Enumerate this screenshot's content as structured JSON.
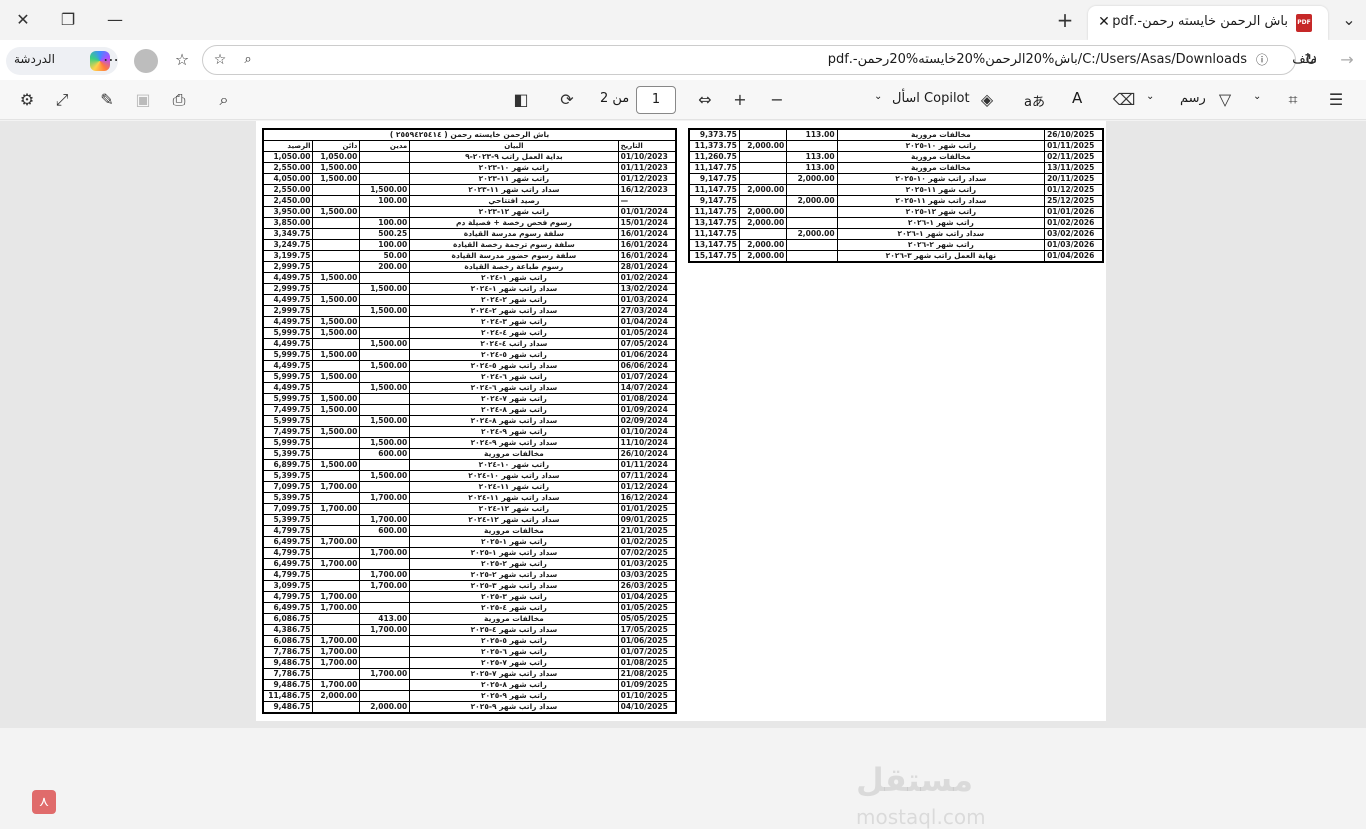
{
  "window": {
    "tab_title": "باش الرحمن خايسته رحمن-.pdf",
    "close": "✕",
    "new_tab": "+",
    "minimize": "—",
    "restore": "❐",
    "window_close": "✕",
    "tabs_menu": "⌄"
  },
  "address": {
    "copilot_label": "الدردشة",
    "file_label": "ملف",
    "url": "C:/Users/Asas/Downloads/باش%20الرحمن%20خايسته%20رحمن-.pdf"
  },
  "toolbar": {
    "draw_label": "رسم",
    "ask_copilot": "اسأل Copilot",
    "page_number": "1",
    "page_of": "من 2",
    "translate": "aあ",
    "read_aloud": "A",
    "zoom_in": "+",
    "zoom_out": "−"
  },
  "page_title": "باش الرحمن خايسته رحمن ( ٢٥٥٩٤٢٥٤١٤ )",
  "headers": {
    "date": "التاريخ",
    "desc": "البيان",
    "debit": "مدين",
    "credit": "دائن",
    "balance": "الرصيد"
  },
  "rows_left": [
    [
      "01/10/2023",
      "بداية العمل راتب ٩-٢٠٢٣-٩",
      "",
      "1,050.00",
      "1,050.00"
    ],
    [
      "01/11/2023",
      "راتب شهر ١٠-٢٠٢٣",
      "",
      "1,500.00",
      "2,550.00"
    ],
    [
      "01/12/2023",
      "راتب شهر ١١-٢٠٢٣",
      "",
      "1,500.00",
      "4,050.00"
    ],
    [
      "16/12/2023",
      "سداد راتب شهر ١١-٢٠٢٣",
      "1,500.00",
      "",
      "2,550.00"
    ],
    [
      "—",
      "رصيد افتتاحي",
      "100.00",
      "",
      "2,450.00"
    ],
    [
      "01/01/2024",
      "راتب شهر ١٢-٢٠٢٣",
      "",
      "1,500.00",
      "3,950.00"
    ],
    [
      "15/01/2024",
      "رسوم فحص رخصة + فصيلة دم",
      "100.00",
      "",
      "3,850.00"
    ],
    [
      "16/01/2024",
      "سلفة رسوم مدرسة القيادة",
      "500.25",
      "",
      "3,349.75"
    ],
    [
      "16/01/2024",
      "سلفة رسوم ترجمة رخصة القيادة",
      "100.00",
      "",
      "3,249.75"
    ],
    [
      "16/01/2024",
      "سلفة رسوم حضور مدرسة القيادة",
      "50.00",
      "",
      "3,199.75"
    ],
    [
      "28/01/2024",
      "رسوم طباعة رخصة القيادة",
      "200.00",
      "",
      "2,999.75"
    ],
    [
      "01/02/2024",
      "راتب شهر ١-٢٠٢٤",
      "",
      "1,500.00",
      "4,499.75"
    ],
    [
      "13/02/2024",
      "سداد راتب شهر ١-٢٠٢٤",
      "1,500.00",
      "",
      "2,999.75"
    ],
    [
      "01/03/2024",
      "راتب شهر ٢-٢٠٢٤",
      "",
      "1,500.00",
      "4,499.75"
    ],
    [
      "27/03/2024",
      "سداد راتب شهر ٢-٢٠٢٤",
      "1,500.00",
      "",
      "2,999.75"
    ],
    [
      "01/04/2024",
      "راتب شهر ٣-٢٠٢٤",
      "",
      "1,500.00",
      "4,499.75"
    ],
    [
      "01/05/2024",
      "راتب شهر ٤-٢٠٢٤",
      "",
      "1,500.00",
      "5,999.75"
    ],
    [
      "07/05/2024",
      "سداد راتب ٤-٢٠٢٤",
      "1,500.00",
      "",
      "4,499.75"
    ],
    [
      "01/06/2024",
      "راتب شهر ٥-٢٠٢٤",
      "",
      "1,500.00",
      "5,999.75"
    ],
    [
      "06/06/2024",
      "سداد راتب شهر ٥-٢٠٢٤",
      "1,500.00",
      "",
      "4,499.75"
    ],
    [
      "01/07/2024",
      "راتب شهر ٦-٢٠٢٤",
      "",
      "1,500.00",
      "5,999.75"
    ],
    [
      "14/07/2024",
      "سداد راتب شهر ٦-٢٠٢٤",
      "1,500.00",
      "",
      "4,499.75"
    ],
    [
      "01/08/2024",
      "راتب شهر ٧-٢٠٢٤",
      "",
      "1,500.00",
      "5,999.75"
    ],
    [
      "01/09/2024",
      "راتب شهر ٨-٢٠٢٤",
      "",
      "1,500.00",
      "7,499.75"
    ],
    [
      "02/09/2024",
      "سداد راتب شهر ٨-٢٠٢٤",
      "1,500.00",
      "",
      "5,999.75"
    ],
    [
      "01/10/2024",
      "راتب شهر ٩-٢٠٢٤",
      "",
      "1,500.00",
      "7,499.75"
    ],
    [
      "11/10/2024",
      "سداد راتب شهر ٩-٢٠٢٤",
      "1,500.00",
      "",
      "5,999.75"
    ],
    [
      "26/10/2024",
      "مخالفات مرورية",
      "600.00",
      "",
      "5,399.75"
    ],
    [
      "01/11/2024",
      "راتب شهر ١٠-٢٠٢٤",
      "",
      "1,500.00",
      "6,899.75"
    ],
    [
      "07/11/2024",
      "سداد راتب شهر ١٠-٢٠٢٤",
      "1,500.00",
      "",
      "5,399.75"
    ],
    [
      "01/12/2024",
      "راتب شهر ١١-٢٠٢٤",
      "",
      "1,700.00",
      "7,099.75"
    ],
    [
      "16/12/2024",
      "سداد راتب شهر ١١-٢٠٢٤",
      "1,700.00",
      "",
      "5,399.75"
    ],
    [
      "01/01/2025",
      "راتب شهر ١٢-٢٠٢٤",
      "",
      "1,700.00",
      "7,099.75"
    ],
    [
      "09/01/2025",
      "سداد راتب شهر ١٢-٢٠٢٤",
      "1,700.00",
      "",
      "5,399.75"
    ],
    [
      "21/01/2025",
      "مخالفات مرورية",
      "600.00",
      "",
      "4,799.75"
    ],
    [
      "01/02/2025",
      "راتب شهر ١-٢٠٢٥",
      "",
      "1,700.00",
      "6,499.75"
    ],
    [
      "07/02/2025",
      "سداد راتب شهر ١-٢٠٢٥",
      "1,700.00",
      "",
      "4,799.75"
    ],
    [
      "01/03/2025",
      "راتب شهر ٢-٢٠٢٥",
      "",
      "1,700.00",
      "6,499.75"
    ],
    [
      "03/03/2025",
      "سداد راتب شهر ٢-٢٠٢٥",
      "1,700.00",
      "",
      "4,799.75"
    ],
    [
      "26/03/2025",
      "سداد راتب شهر ٣-٢٠٢٥",
      "1,700.00",
      "",
      "3,099.75"
    ],
    [
      "01/04/2025",
      "راتب شهر ٣-٢٠٢٥",
      "",
      "1,700.00",
      "4,799.75"
    ],
    [
      "01/05/2025",
      "راتب شهر ٤-٢٠٢٥",
      "",
      "1,700.00",
      "6,499.75"
    ],
    [
      "05/05/2025",
      "مخالفات مرورية",
      "413.00",
      "",
      "6,086.75"
    ],
    [
      "17/05/2025",
      "سداد راتب شهر ٤-٢٠٢٥",
      "1,700.00",
      "",
      "4,386.75"
    ],
    [
      "01/06/2025",
      "راتب شهر ٥-٢٠٢٥",
      "",
      "1,700.00",
      "6,086.75"
    ],
    [
      "01/07/2025",
      "راتب شهر ٦-٢٠٢٥",
      "",
      "1,700.00",
      "7,786.75"
    ],
    [
      "01/08/2025",
      "راتب شهر ٧-٢٠٢٥",
      "",
      "1,700.00",
      "9,486.75"
    ],
    [
      "21/08/2025",
      "سداد راتب شهر ٧-٢٠٢٥",
      "1,700.00",
      "",
      "7,786.75"
    ],
    [
      "01/09/2025",
      "راتب شهر ٨-٢٠٢٥",
      "",
      "1,700.00",
      "9,486.75"
    ],
    [
      "01/10/2025",
      "راتب شهر ٩-٢٠٢٥",
      "",
      "2,000.00",
      "11,486.75"
    ],
    [
      "04/10/2025",
      "سداد راتب شهر ٩-٢٠٢٥",
      "2,000.00",
      "",
      "9,486.75"
    ]
  ],
  "rows_right": [
    [
      "26/10/2025",
      "مخالفات مرورية",
      "113.00",
      "",
      "9,373.75"
    ],
    [
      "01/11/2025",
      "راتب شهر ١٠-٢٠٢٥",
      "",
      "2,000.00",
      "11,373.75"
    ],
    [
      "02/11/2025",
      "مخالفات مرورية",
      "113.00",
      "",
      "11,260.75"
    ],
    [
      "13/11/2025",
      "مخالفات مرورية",
      "113.00",
      "",
      "11,147.75"
    ],
    [
      "20/11/2025",
      "سداد راتب شهر ١٠-٢٠٢٥",
      "2,000.00",
      "",
      "9,147.75"
    ],
    [
      "01/12/2025",
      "راتب شهر ١١-٢٠٢٥",
      "",
      "2,000.00",
      "11,147.75"
    ],
    [
      "25/12/2025",
      "سداد راتب شهر ١١-٢٠٢٥",
      "2,000.00",
      "",
      "9,147.75"
    ],
    [
      "01/01/2026",
      "راتب شهر ١٢-٢٠٢٥",
      "",
      "2,000.00",
      "11,147.75"
    ],
    [
      "01/02/2026",
      "راتب شهر ١-٢٠٢٦",
      "",
      "2,000.00",
      "13,147.75"
    ],
    [
      "03/02/2026",
      "سداد راتب شهر ١-٢٠٢٦",
      "2,000.00",
      "",
      "11,147.75"
    ],
    [
      "01/03/2026",
      "راتب شهر ٢-٢٠٢٦",
      "",
      "2,000.00",
      "13,147.75"
    ],
    [
      "01/04/2026",
      "نهاية العمل راتب شهر ٣-٢٠٢٦",
      "",
      "2,000.00",
      "15,147.75"
    ]
  ],
  "watermark": {
    "line1": "مستقل",
    "line2": "mostaql.com"
  },
  "icons": [
    "close-icon",
    "restore-icon",
    "minimize-icon",
    "new-tab-icon",
    "tab-menu-icon",
    "pdf-file-icon",
    "back-icon",
    "refresh-icon",
    "info-icon",
    "search-chat-icon",
    "favorite-icon",
    "favorites-list-icon",
    "more-icon",
    "settings-icon",
    "expand-icon",
    "save-as-icon",
    "save-icon",
    "print-icon",
    "search-icon",
    "page-view-icon",
    "rotate-icon",
    "fit-width-icon",
    "zoom-in-icon",
    "zoom-out-icon",
    "copilot-icon",
    "translate-icon",
    "read-aloud-icon",
    "erase-icon",
    "draw-icon",
    "highlight-icon",
    "contents-icon",
    "acrobat-icon"
  ]
}
